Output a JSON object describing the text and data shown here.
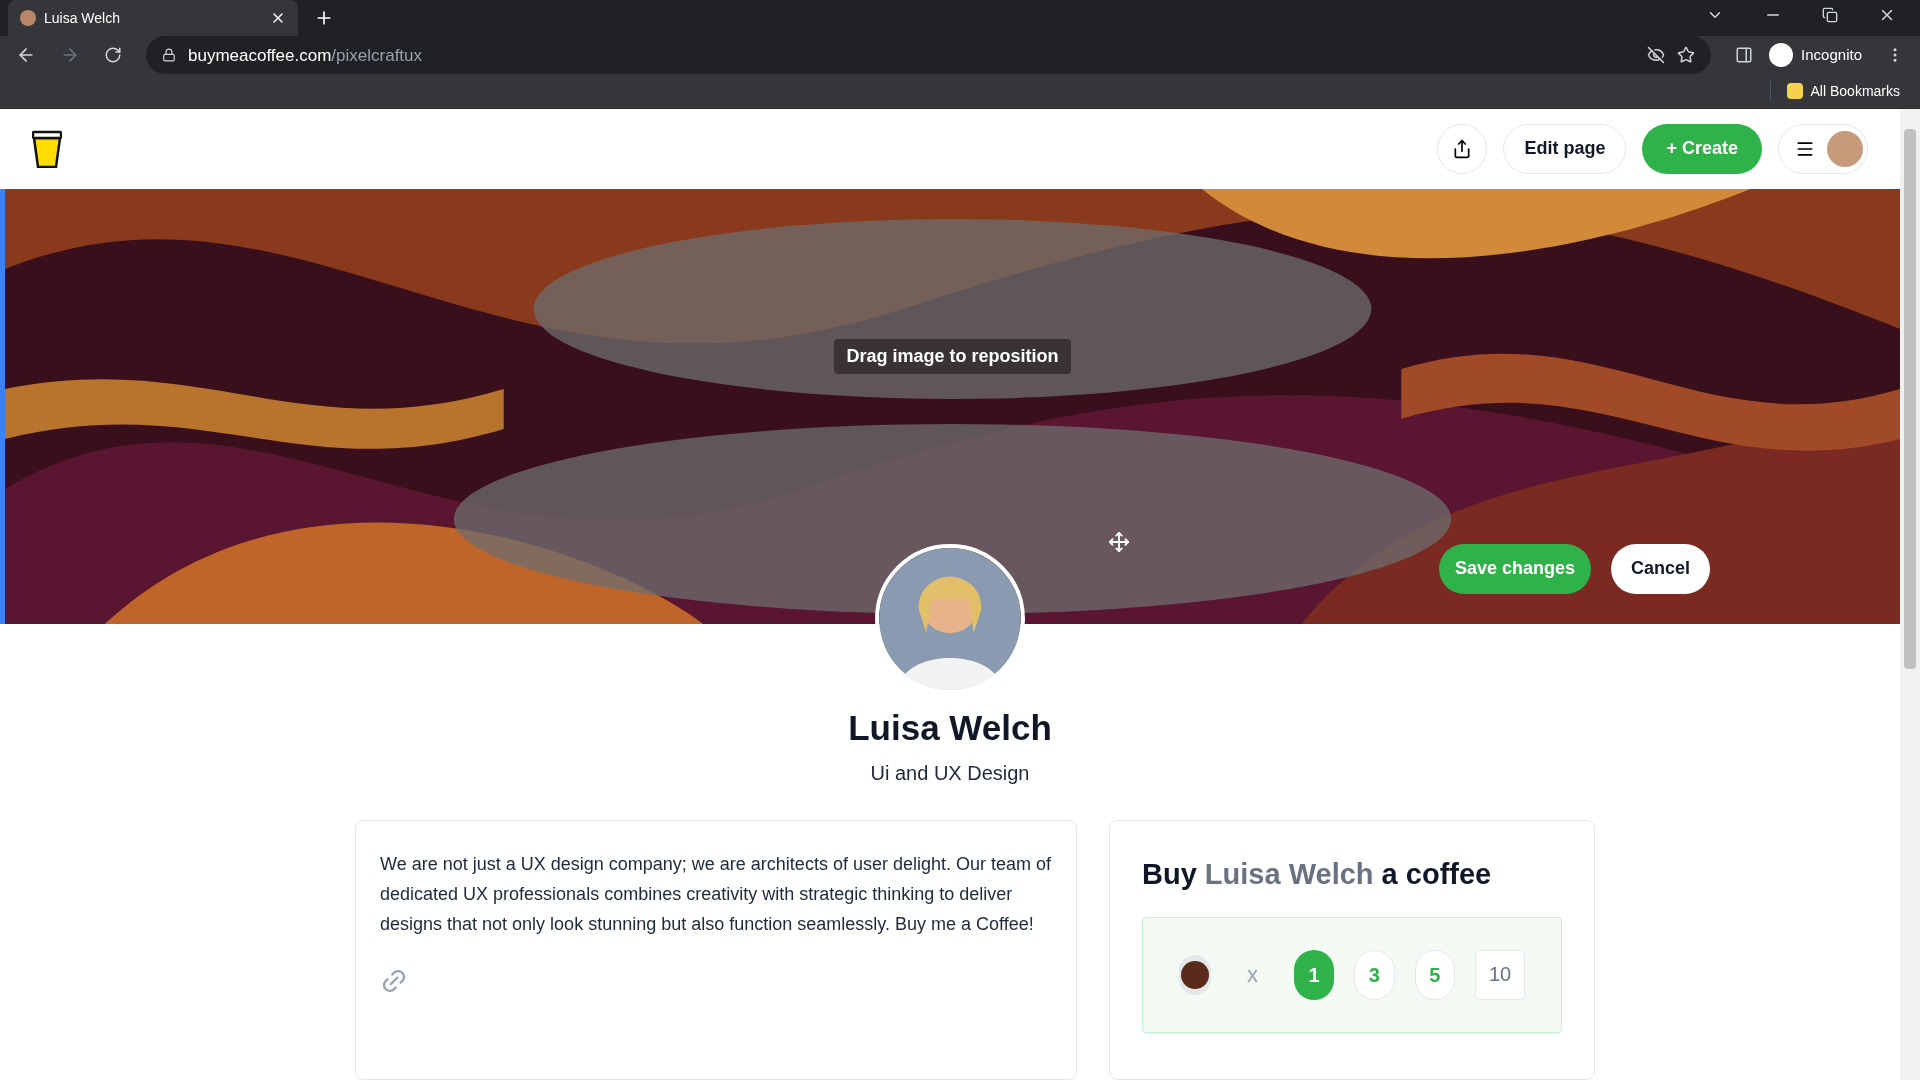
{
  "browser": {
    "tab_title": "Luisa Welch",
    "url_host": "buymeacoffee.com",
    "url_path": "/pixelcraftux",
    "profile_label": "Incognito",
    "bookmarks_label": "All Bookmarks"
  },
  "header": {
    "edit_label": "Edit page",
    "create_label": "+ Create"
  },
  "banner": {
    "kind": "picture",
    "hint": "Drag image to reposition",
    "save_label": "Save changes",
    "cancel_label": "Cancel"
  },
  "profile": {
    "name": "Luisa Welch",
    "tagline": "Ui and UX Design"
  },
  "about": {
    "text": "We are not just a UX design company; we are architects of user delight. Our team of dedicated UX professionals combines creativity with strategic thinking to deliver designs that not only look stunning but also function seamlessly. Buy me a Coffee!"
  },
  "support": {
    "title_start": "Buy",
    "title_name": "Luisa Welch",
    "title_end": "a coffee",
    "multiplier": "x",
    "quantities": [
      {
        "kind": "option",
        "label": "1",
        "selected": true
      },
      {
        "kind": "option",
        "label": "3",
        "selected": false
      },
      {
        "kind": "option",
        "label": "5",
        "selected": false
      },
      {
        "kind": "field",
        "label": "10",
        "selected": false
      }
    ]
  }
}
